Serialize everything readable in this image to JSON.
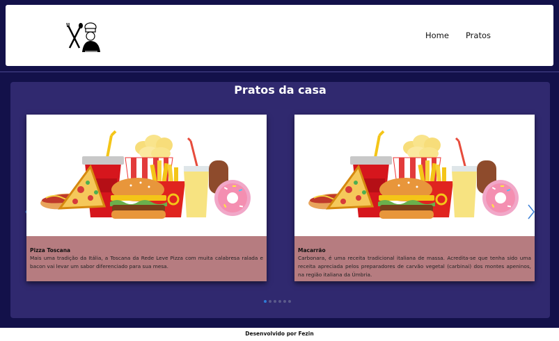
{
  "header": {
    "logo_icon": "chef-logo-icon",
    "nav": [
      {
        "label": "Home"
      },
      {
        "label": "Pratos"
      }
    ]
  },
  "main": {
    "title": "Pratos da casa",
    "cards": [
      {
        "image_icon": "fast-food-illustration",
        "title": "Pizza Toscana",
        "text": "Mais uma tradição da Itália, a Toscana da Rede Leve Pizza com muita calabresa ralada e bacon vai levar um sabor diferenciado para sua mesa."
      },
      {
        "image_icon": "fast-food-illustration",
        "title": "Macarrão",
        "text": "Carbonara, é uma receita tradicional italiana de massa. Acredita-se que tenha sido uma receita apreciada pelos preparadores de carvão vegetal (carbinai) dos montes apeninos, na região italiana da Úmbria."
      }
    ],
    "carousel": {
      "slides": 6,
      "active": 1,
      "prev_icon": "chevron-left-icon",
      "next_icon": "chevron-right-icon"
    }
  },
  "footer": {
    "text": "Desenvolvido por Fezin"
  },
  "colors": {
    "background": "#13114a",
    "section": "#30296f",
    "card_body": "#b67c80",
    "accent": "#2e7bd6"
  }
}
